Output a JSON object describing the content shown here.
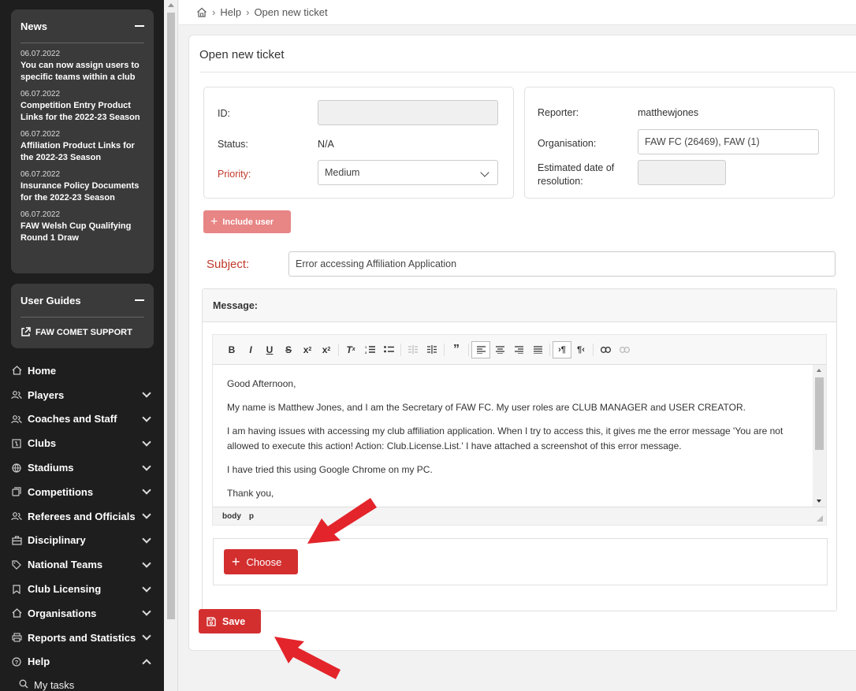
{
  "sidebar": {
    "news": {
      "title": "News",
      "items": [
        {
          "date": "06.07.2022",
          "title": "You can now assign users to specific teams within a club"
        },
        {
          "date": "06.07.2022",
          "title": "Competition Entry Product Links for the 2022-23 Season"
        },
        {
          "date": "06.07.2022",
          "title": "Affiliation Product Links for the 2022-23 Season"
        },
        {
          "date": "06.07.2022",
          "title": "Insurance Policy Documents for the 2022-23 Season"
        },
        {
          "date": "06.07.2022",
          "title": "FAW Welsh Cup Qualifying Round 1 Draw"
        }
      ]
    },
    "guides": {
      "title": "User Guides",
      "link": "FAW COMET SUPPORT"
    },
    "nav": [
      {
        "label": "Home",
        "icon": "home-icon"
      },
      {
        "label": "Players",
        "icon": "players-icon"
      },
      {
        "label": "Coaches and Staff",
        "icon": "coaches-icon"
      },
      {
        "label": "Clubs",
        "icon": "clubs-icon"
      },
      {
        "label": "Stadiums",
        "icon": "globe-icon"
      },
      {
        "label": "Competitions",
        "icon": "competitions-icon"
      },
      {
        "label": "Referees and Officials",
        "icon": "referees-icon"
      },
      {
        "label": "Disciplinary",
        "icon": "briefcase-icon"
      },
      {
        "label": "National Teams",
        "icon": "tag-icon"
      },
      {
        "label": "Club Licensing",
        "icon": "bookmark-icon"
      },
      {
        "label": "Organisations",
        "icon": "organisation-icon"
      },
      {
        "label": "Reports and Statistics",
        "icon": "printer-icon"
      },
      {
        "label": "Help",
        "icon": "help-icon"
      }
    ],
    "sub": {
      "label": "My tasks",
      "icon": "search-icon"
    }
  },
  "breadcrumb": {
    "items": [
      "Help",
      "Open new ticket"
    ]
  },
  "ticket": {
    "title": "Open new ticket",
    "id_label": "ID:",
    "id_value": "",
    "status_label": "Status:",
    "status_value": "N/A",
    "priority_label": "Priority:",
    "priority_value": "Medium",
    "reporter_label": "Reporter:",
    "reporter_value": "matthewjones",
    "org_label": "Organisation:",
    "org_value": "FAW FC (26469), FAW (1)",
    "est_label": "Estimated date of resolution:",
    "est_value": "",
    "include_user": "Include user",
    "subject_label": "Subject:",
    "subject_value": "Error accessing Affiliation Application",
    "message_label": "Message:",
    "message_paragraphs": [
      "Good Afternoon,",
      "My name is Matthew Jones, and I am the Secretary of FAW FC. My user roles are CLUB MANAGER and USER CREATOR.",
      "I am having issues with accessing my club affiliation application. When I try to access this, it gives me the error message 'You are not allowed to execute this action! Action: Club.License.List.' I have attached a screenshot of this error message.",
      "I have tried this using Google Chrome on my PC.",
      "Thank you,"
    ],
    "path_body": "body",
    "path_p": "p",
    "choose_label": "Choose",
    "save_label": "Save"
  },
  "colors": {
    "accent": "#d32f2f",
    "sidebar": "#1e1e1e",
    "label_red": "#c0392b"
  }
}
